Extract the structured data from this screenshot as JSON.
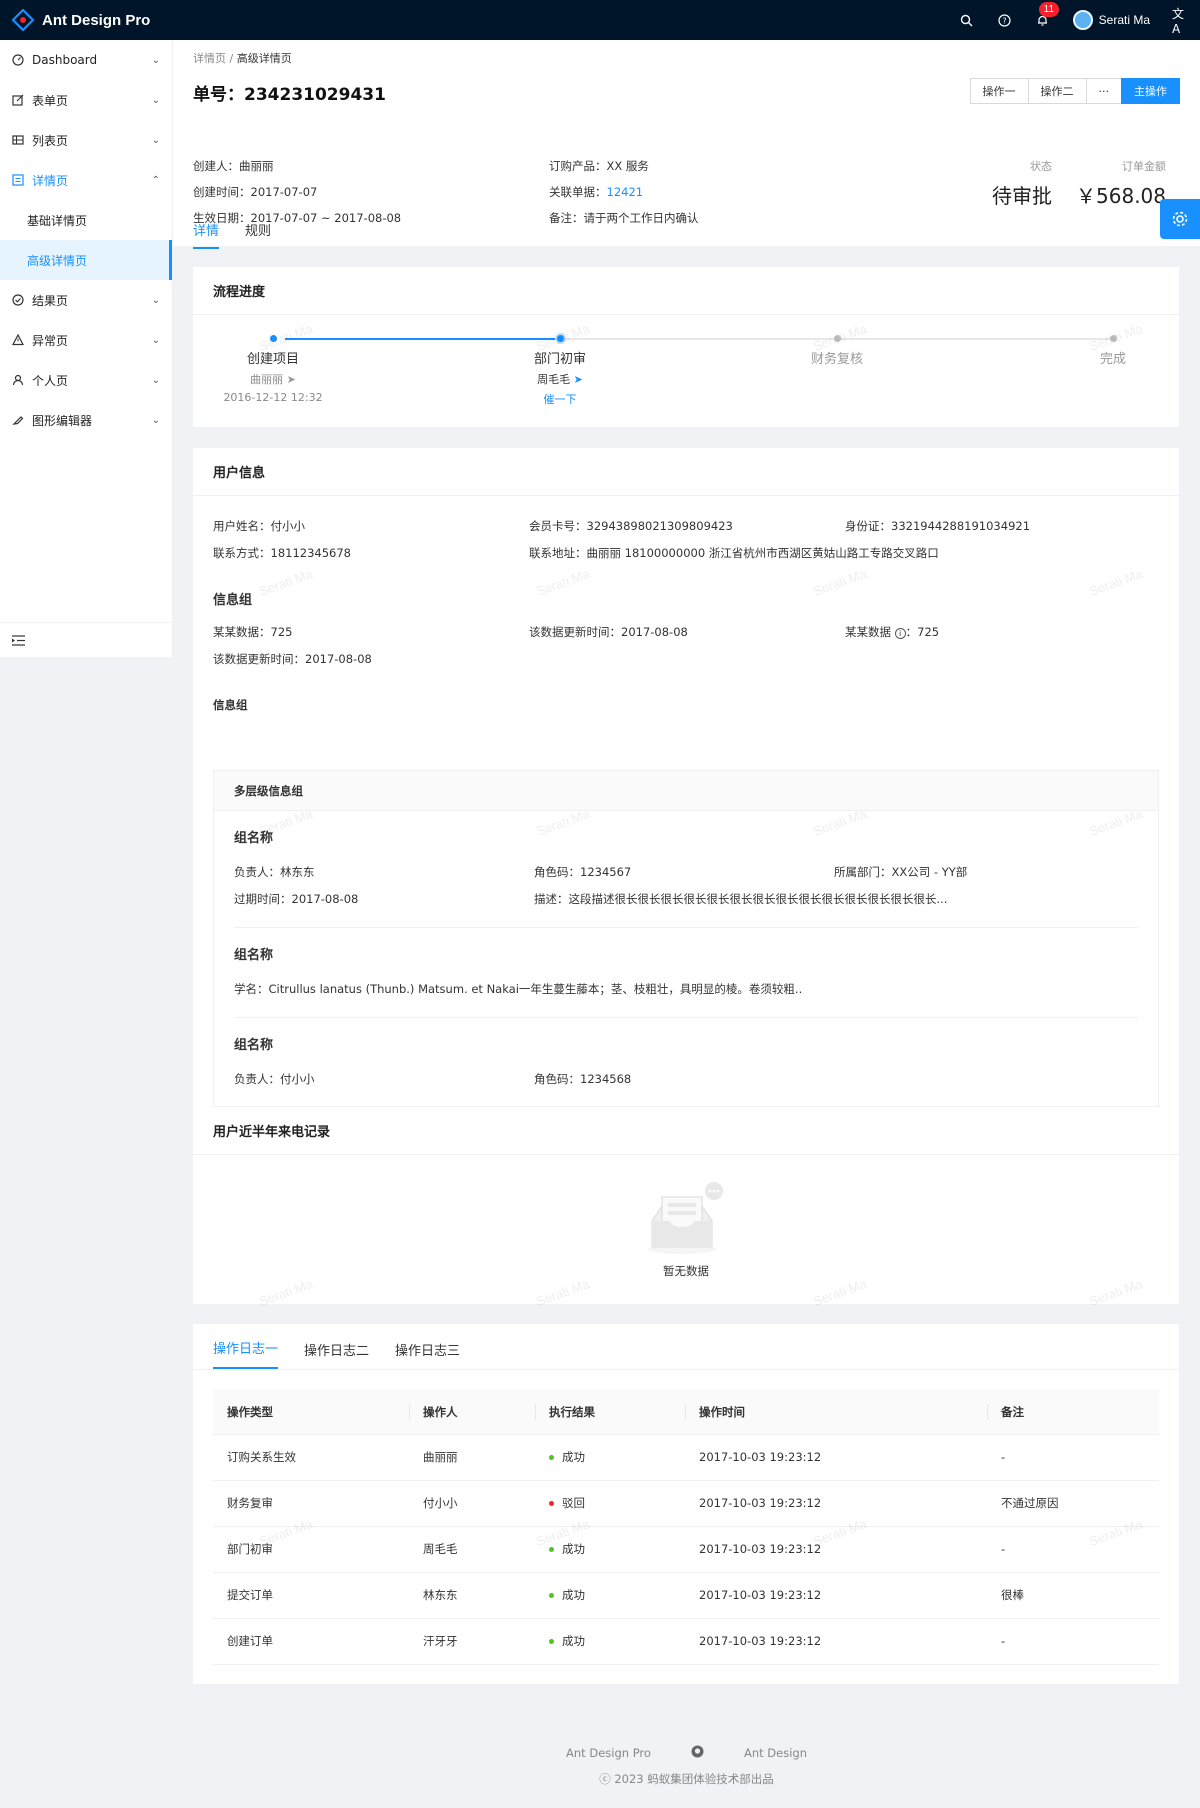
{
  "app": {
    "title": "Ant Design Pro"
  },
  "topbar": {
    "notification_count": "11",
    "user_name": "Serati Ma"
  },
  "sidebar": {
    "items": [
      {
        "label": "Dashboard",
        "icon": "dashboard-icon"
      },
      {
        "label": "表单页",
        "icon": "form-icon"
      },
      {
        "label": "列表页",
        "icon": "table-icon"
      },
      {
        "label": "详情页",
        "icon": "profile-icon"
      },
      {
        "label": "基础详情页"
      },
      {
        "label": "高级详情页"
      },
      {
        "label": "结果页",
        "icon": "check-circle-icon"
      },
      {
        "label": "异常页",
        "icon": "warning-icon"
      },
      {
        "label": "个人页",
        "icon": "user-icon"
      },
      {
        "label": "图形编辑器",
        "icon": "highlight-icon"
      }
    ]
  },
  "header": {
    "breadcrumb": [
      "详情页",
      "高级详情页"
    ],
    "order_title": "单号：234231029431",
    "actions": {
      "op1": "操作一",
      "op2": "操作二",
      "more": "···",
      "main": "主操作"
    },
    "desc": {
      "creator": "创建人：曲丽丽",
      "product": "订购产品：XX 服务",
      "created": "创建时间：2017-07-07",
      "ref_label": "关联单据：",
      "ref_value": "12421",
      "effective": "生效日期：2017-07-07 ~ 2017-08-08",
      "remark": "备注：请于两个工作日内确认"
    },
    "status_label": "状态",
    "status_value": "待审批",
    "amount_label": "订单金额",
    "amount_value": "￥568.08",
    "tabs": [
      "详情",
      "规则"
    ]
  },
  "progress": {
    "title": "流程进度",
    "steps": [
      {
        "title": "创建项目",
        "person": "曲丽丽",
        "time": "2016-12-12 12:32"
      },
      {
        "title": "部门初审",
        "person": "周毛毛",
        "urge": "催一下"
      },
      {
        "title": "财务复核"
      },
      {
        "title": "完成"
      }
    ]
  },
  "user_info": {
    "title": "用户信息",
    "name": "用户姓名：付小小",
    "card": "会员卡号：32943898021309809423",
    "idcard": "身份证：3321944288191034921",
    "phone": "联系方式：18112345678",
    "address": "联系地址：曲丽丽 18100000000 浙江省杭州市西湖区黄姑山路工专路交叉路口",
    "group_title": "信息组",
    "data1": "某某数据：725",
    "updated1": "该数据更新时间：2017-08-08",
    "data2_label": "某某数据",
    "data2_value": "：725",
    "updated2": "该数据更新时间：2017-08-08",
    "group_label2": "信息组",
    "multi_title": "多层级信息组",
    "groups": {
      "g1_title": "组名称",
      "g1_owner": "负责人：林东东",
      "g1_role": "角色码：1234567",
      "g1_dept": "所属部门：XX公司 - YY部",
      "g1_expire": "过期时间：2017-08-08",
      "g1_desc": "描述：这段描述很长很长很长很长很长很长很长很长很长很长很长很长很长很长...",
      "g2_title": "组名称",
      "g2_sci": "学名：Citrullus lanatus (Thunb.) Matsum. et Nakai一年生蔓生藤本；茎、枝粗壮，具明显的棱。卷须较粗..",
      "g3_title": "组名称",
      "g3_owner": "负责人：付小小",
      "g3_role": "角色码：1234568"
    }
  },
  "calls": {
    "title": "用户近半年来电记录",
    "empty": "暂无数据"
  },
  "logs": {
    "tabs": [
      "操作日志一",
      "操作日志二",
      "操作日志三"
    ],
    "columns": [
      "操作类型",
      "操作人",
      "执行结果",
      "操作时间",
      "备注"
    ],
    "rows": [
      {
        "type": "订购关系生效",
        "op": "曲丽丽",
        "result": "成功",
        "ok": true,
        "time": "2017-10-03 19:23:12",
        "note": "-"
      },
      {
        "type": "财务复审",
        "op": "付小小",
        "result": "驳回",
        "ok": false,
        "time": "2017-10-03 19:23:12",
        "note": "不通过原因"
      },
      {
        "type": "部门初审",
        "op": "周毛毛",
        "result": "成功",
        "ok": true,
        "time": "2017-10-03 19:23:12",
        "note": "-"
      },
      {
        "type": "提交订单",
        "op": "林东东",
        "result": "成功",
        "ok": true,
        "time": "2017-10-03 19:23:12",
        "note": "很棒"
      },
      {
        "type": "创建订单",
        "op": "汗牙牙",
        "result": "成功",
        "ok": true,
        "time": "2017-10-03 19:23:12",
        "note": "-"
      }
    ]
  },
  "footer": {
    "link1": "Ant Design Pro",
    "link2": "Ant Design",
    "copyright": "ⓒ 2023 蚂蚁集团体验技术部出品"
  },
  "watermark": "Serati Ma",
  "colors": {
    "primary": "#1890ff",
    "success": "#52c41a",
    "error": "#f5222d",
    "header_bg": "#001529"
  }
}
